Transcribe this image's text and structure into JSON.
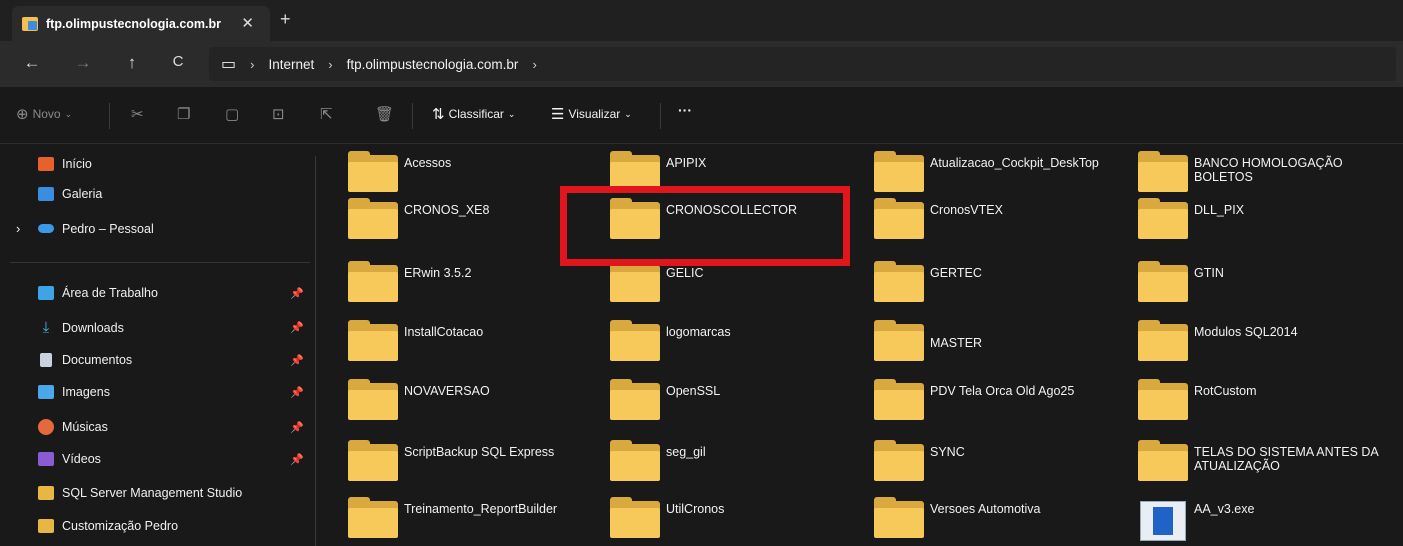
{
  "tab": {
    "title": "ftp.olimpustecnologia.com.br",
    "close_icon": "✕",
    "new_tab_icon": "+"
  },
  "nav": {
    "back_icon": "←",
    "forward_icon": "→",
    "up_icon": "↑",
    "refresh_icon": "C",
    "monitor_icon": "▭",
    "breadcrumb": [
      "Internet",
      "ftp.olimpustecnologia.com.br"
    ],
    "separator": "›"
  },
  "toolbar": {
    "new_label": "Novo",
    "sort_label": "Classificar",
    "view_label": "Visualizar",
    "more_label": "···"
  },
  "sidebar": {
    "top_items": [
      {
        "label": "Início",
        "icon": "home-icon",
        "color": "#e7612d"
      },
      {
        "label": "Galeria",
        "icon": "gallery-icon",
        "color": "#3b8de0"
      },
      {
        "label": "Pedro – Pessoal",
        "icon": "cloud-icon",
        "color": "#3a9ae8"
      }
    ],
    "pinned_items": [
      {
        "label": "Área de Trabalho",
        "icon": "desktop-icon",
        "color": "#3fa3e8"
      },
      {
        "label": "Downloads",
        "icon": "download-icon",
        "color": "#42b6f5"
      },
      {
        "label": "Documentos",
        "icon": "documents-icon",
        "color": "#c9d3df"
      },
      {
        "label": "Imagens",
        "icon": "images-icon",
        "color": "#4aa8e8"
      },
      {
        "label": "Músicas",
        "icon": "music-icon",
        "color": "#e46a3c"
      },
      {
        "label": "Vídeos",
        "icon": "videos-icon",
        "color": "#8b5bd6"
      },
      {
        "label": "SQL Server Management Studio",
        "icon": "folder-icon",
        "color": "#e8b743"
      },
      {
        "label": "Customização Pedro",
        "icon": "folder-icon",
        "color": "#e8b743"
      }
    ],
    "pin_glyph": "📌"
  },
  "files": [
    {
      "name": "Acessos",
      "type": "folder"
    },
    {
      "name": "APIPIX",
      "type": "folder"
    },
    {
      "name": "Atualizacao_Cockpit_DeskTop",
      "type": "folder"
    },
    {
      "name": "BANCO HOMOLOGAÇÃO BOLETOS",
      "type": "folder"
    },
    {
      "name": "CRONOS_XE8",
      "type": "folder"
    },
    {
      "name": "CRONOSCOLLECTOR",
      "type": "folder"
    },
    {
      "name": "CronosVTEX",
      "type": "folder"
    },
    {
      "name": "DLL_PIX",
      "type": "folder"
    },
    {
      "name": "ERwin 3.5.2",
      "type": "folder"
    },
    {
      "name": "GELIC",
      "type": "folder"
    },
    {
      "name": "GERTEC",
      "type": "folder"
    },
    {
      "name": "GTIN",
      "type": "folder"
    },
    {
      "name": "InstallCotacao",
      "type": "folder"
    },
    {
      "name": "logomarcas",
      "type": "folder"
    },
    {
      "name": "MASTER",
      "type": "folder"
    },
    {
      "name": "Modulos SQL2014",
      "type": "folder"
    },
    {
      "name": "NOVAVERSAO",
      "type": "folder"
    },
    {
      "name": "OpenSSL",
      "type": "folder"
    },
    {
      "name": "PDV Tela Orca Old Ago25",
      "type": "folder"
    },
    {
      "name": "RotCustom",
      "type": "folder"
    },
    {
      "name": "ScriptBackup SQL Express",
      "type": "folder"
    },
    {
      "name": "seg_gil",
      "type": "folder"
    },
    {
      "name": "SYNC",
      "type": "folder"
    },
    {
      "name": "TELAS DO SISTEMA ANTES DA ATUALIZAÇÃO",
      "type": "folder"
    },
    {
      "name": "Treinamento_ReportBuilder",
      "type": "folder"
    },
    {
      "name": "UtilCronos",
      "type": "folder"
    },
    {
      "name": "Versoes Automotiva",
      "type": "folder"
    },
    {
      "name": "AA_v3.exe",
      "type": "exe"
    }
  ],
  "colors": {
    "highlight": "#e0161c",
    "folder": "#f7c95a"
  }
}
